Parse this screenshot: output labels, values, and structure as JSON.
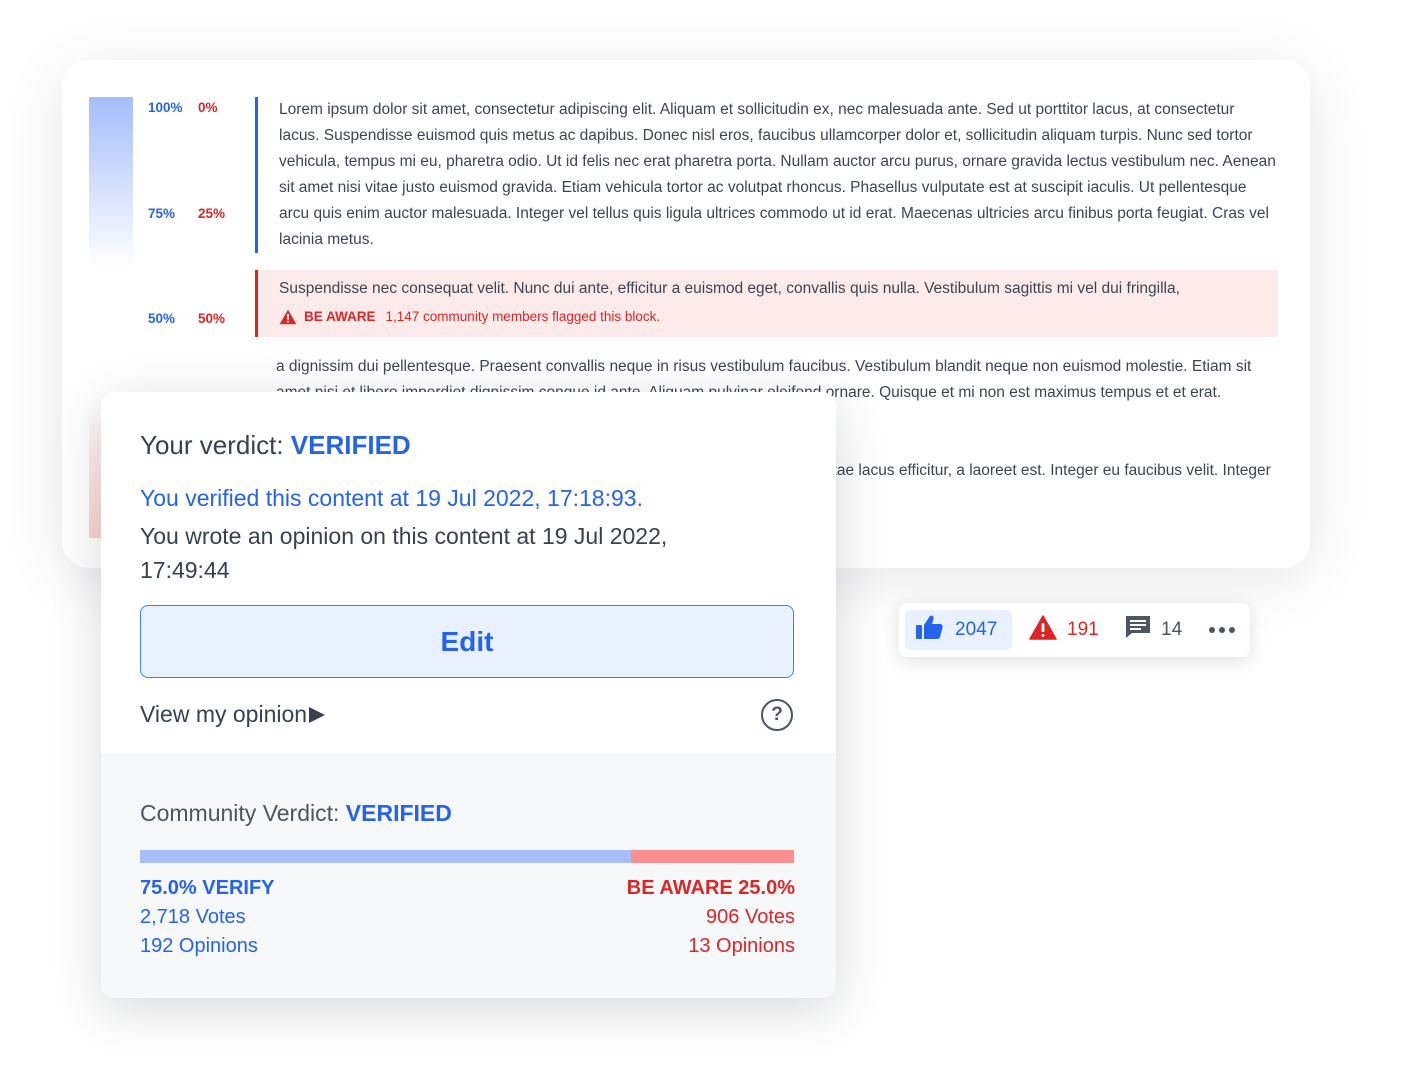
{
  "scale": {
    "rows": [
      {
        "verify": "100%",
        "aware": "0%"
      },
      {
        "verify": "75%",
        "aware": "25%"
      },
      {
        "verify": "50%",
        "aware": "50%"
      }
    ]
  },
  "article": {
    "paragraph_1": "Lorem ipsum dolor sit amet, consectetur adipiscing elit. Aliquam et sollicitudin ex, nec malesuada ante. Sed ut porttitor lacus, at consectetur lacus. Suspendisse euismod quis metus ac dapibus. Donec nisl eros, faucibus ullamcorper dolor et, sollicitudin aliquam turpis. Nunc sed tortor vehicula, tempus mi eu, pharetra odio. Ut id felis nec erat pharetra porta. Nullam auctor arcu purus, ornare gravida lectus vestibulum nec. Aenean sit amet nisi vitae justo euismod gravida. Etiam vehicula tortor ac volutpat rhoncus. Phasellus vulputate est at suscipit iaculis. Ut pellentesque arcu quis enim auctor malesuada. Integer vel tellus quis ligula ultrices commodo ut id erat. Maecenas ultricies arcu finibus porta feugiat. Cras vel lacinia metus.",
    "paragraph_2": "Suspendisse nec consequat velit. Nunc dui ante, efficitur a euismod eget, convallis quis nulla. Vestibulum sagittis mi vel dui fringilla,",
    "aware_label": "BE AWARE",
    "aware_text": "1,147 community members flagged this block.",
    "paragraph_3": "a dignissim dui pellentesque. Praesent convallis neque in risus vestibulum faucibus. Vestibulum blandit neque non euismod molestie. Etiam sit amet nisi et libero imperdiet dignissim congue id ante. Aliquam pulvinar eleifend ornare. Quisque et mi non est maximus tempus et et erat.",
    "paragraph_4": "Lorem ipsum dolor sit amet, consectetur adipiscing elit. Phasellus facilisis nunc vitae lacus efficitur, a laoreet est. Integer eu faucibus velit. Integer ut lectus vehicula, ultricies mi laoreet ac viverra ac, sollicitudin at enim."
  },
  "verdict": {
    "title_prefix": "Your verdict:",
    "title_value": "VERIFIED",
    "verified_at": "You verified this content at 19 Jul 2022, 17:18:93.",
    "opinion_at": "You wrote an opinion on this content at 19 Jul 2022, 17:49:44",
    "edit_label": "Edit",
    "view_opinion_label": "View my opinion",
    "help_symbol": "?"
  },
  "community": {
    "title_prefix": "Community Verdict:",
    "title_value": "VERIFIED",
    "verify_fraction": 0.75,
    "verify_head": "75.0% VERIFY",
    "verify_votes": "2,718 Votes",
    "verify_opinions": "192 Opinions",
    "aware_head": "BE AWARE 25.0%",
    "aware_votes": "906 Votes",
    "aware_opinions": "13 Opinions"
  },
  "reactions": {
    "likes": "2047",
    "flags": "191",
    "comments": "14",
    "icons": [
      "thumbs-up-icon",
      "warning-icon",
      "comment-icon",
      "more-icon"
    ]
  },
  "colors": {
    "verify": "#2563eb",
    "aware": "#dc2626",
    "verify_bar": "#a8bdfb",
    "aware_bar": "#fb8e8e",
    "aware_bg": "#fdeaea"
  }
}
